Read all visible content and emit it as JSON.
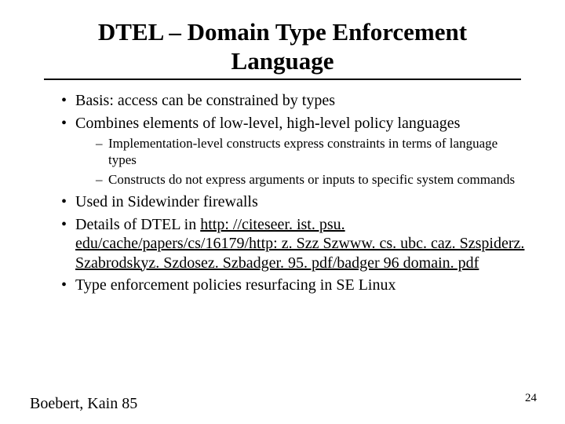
{
  "title": "DTEL – Domain Type Enforcement Language",
  "bullets": {
    "b1": "Basis: access can be constrained by types",
    "b2": "Combines elements of low-level, high-level policy languages",
    "b2_sub1": "Implementation-level constructs express constraints in terms of language types",
    "b2_sub2": "Constructs do not express arguments or inputs to specific system commands",
    "b3": "Used in Sidewinder firewalls",
    "b4_prefix": "Details of DTEL in ",
    "b4_link": "http: //citeseer. ist. psu. edu/cache/papers/cs/16179/http: z. Szz Szwww. cs. ubc. caz. Szspiderz. Szabrodskyz. Szdosez. Szbadger. 95. pdf/badger 96 domain. pdf",
    "b5": "Type enforcement policies resurfacing in SE Linux"
  },
  "footer_left": "Boebert, Kain 85",
  "page_number": "24"
}
